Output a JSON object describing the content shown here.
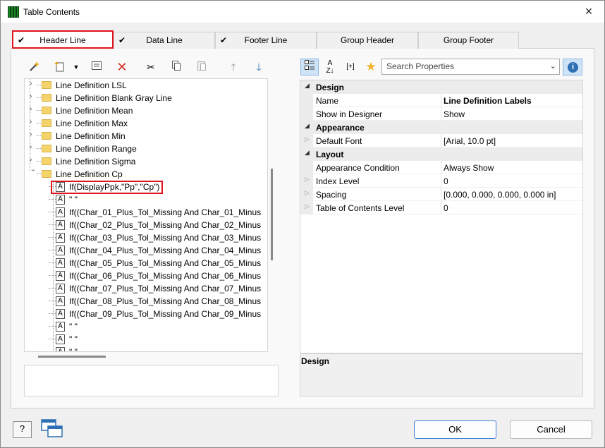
{
  "window": {
    "title": "Table Contents",
    "close_icon": "×"
  },
  "tabs": [
    {
      "label": "Header Line",
      "checked": true
    },
    {
      "label": "Data Line",
      "checked": true
    },
    {
      "label": "Footer Line",
      "checked": true
    },
    {
      "label": "Group Header",
      "checked": false
    },
    {
      "label": "Group Footer",
      "checked": false
    }
  ],
  "tree": {
    "folders": [
      "Line Definition LSL",
      "Line Definition Blank Gray Line",
      "Line Definition Mean",
      "Line Definition Max",
      "Line Definition Min",
      "Line Definition Range",
      "Line Definition Sigma",
      "Line Definition Cp"
    ],
    "children": [
      "If(DisplayPpk,\"Pp\",\"Cp\")",
      "\" \"",
      "If((Char_01_Plus_Tol_Missing And Char_01_Minus",
      "If((Char_02_Plus_Tol_Missing And Char_02_Minus",
      "If((Char_03_Plus_Tol_Missing And Char_03_Minus",
      "If((Char_04_Plus_Tol_Missing And Char_04_Minus",
      "If((Char_05_Plus_Tol_Missing And Char_05_Minus",
      "If((Char_06_Plus_Tol_Missing And Char_06_Minus",
      "If((Char_07_Plus_Tol_Missing And Char_07_Minus",
      "If((Char_08_Plus_Tol_Missing And Char_08_Minus",
      "If((Char_09_Plus_Tol_Missing And Char_09_Minus",
      "\" \"",
      "\" \"",
      "\" \""
    ]
  },
  "search": {
    "placeholder": "Search Properties"
  },
  "properties": {
    "design_header": "Design",
    "name_label": "Name",
    "name_value": "Line Definition Labels",
    "show_label": "Show in Designer",
    "show_value": "Show",
    "appearance_header": "Appearance",
    "font_label": "Default Font",
    "font_value": "[Arial, 10.0 pt]",
    "layout_header": "Layout",
    "cond_label": "Appearance Condition",
    "cond_value": "Always Show",
    "index_label": "Index Level",
    "index_value": "0",
    "spacing_label": "Spacing",
    "spacing_value": "[0.000, 0.000, 0.000, 0.000 in]",
    "toc_label": "Table of Contents Level",
    "toc_value": "0"
  },
  "description": {
    "title": "Design"
  },
  "buttons": {
    "ok": "OK",
    "cancel": "Cancel",
    "help": "?"
  }
}
